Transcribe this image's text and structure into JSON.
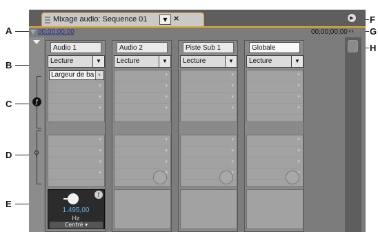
{
  "panel": {
    "tab_title": "Mixage audio: Sequence 01",
    "timecode_left": "00;00;00;00",
    "timecode_right": "00;00;00;00"
  },
  "tracks": [
    {
      "name": "Audio 1",
      "mode": "Lecture"
    },
    {
      "name": "Audio 2",
      "mode": "Lecture"
    },
    {
      "name": "Piste Sub 1",
      "mode": "Lecture"
    },
    {
      "name": "Globale",
      "mode": "Lecture"
    }
  ],
  "effect": {
    "label": "Largeur de ba",
    "value": "1.495,00",
    "unit": "Hz",
    "channel": "Centré"
  },
  "callouts": [
    "A",
    "B",
    "C",
    "D",
    "E",
    "F",
    "G",
    "H"
  ],
  "colors": {
    "accent": "#e4a72a",
    "timecode_link": "#1e2f8c",
    "value_blue": "#62b0ef"
  }
}
